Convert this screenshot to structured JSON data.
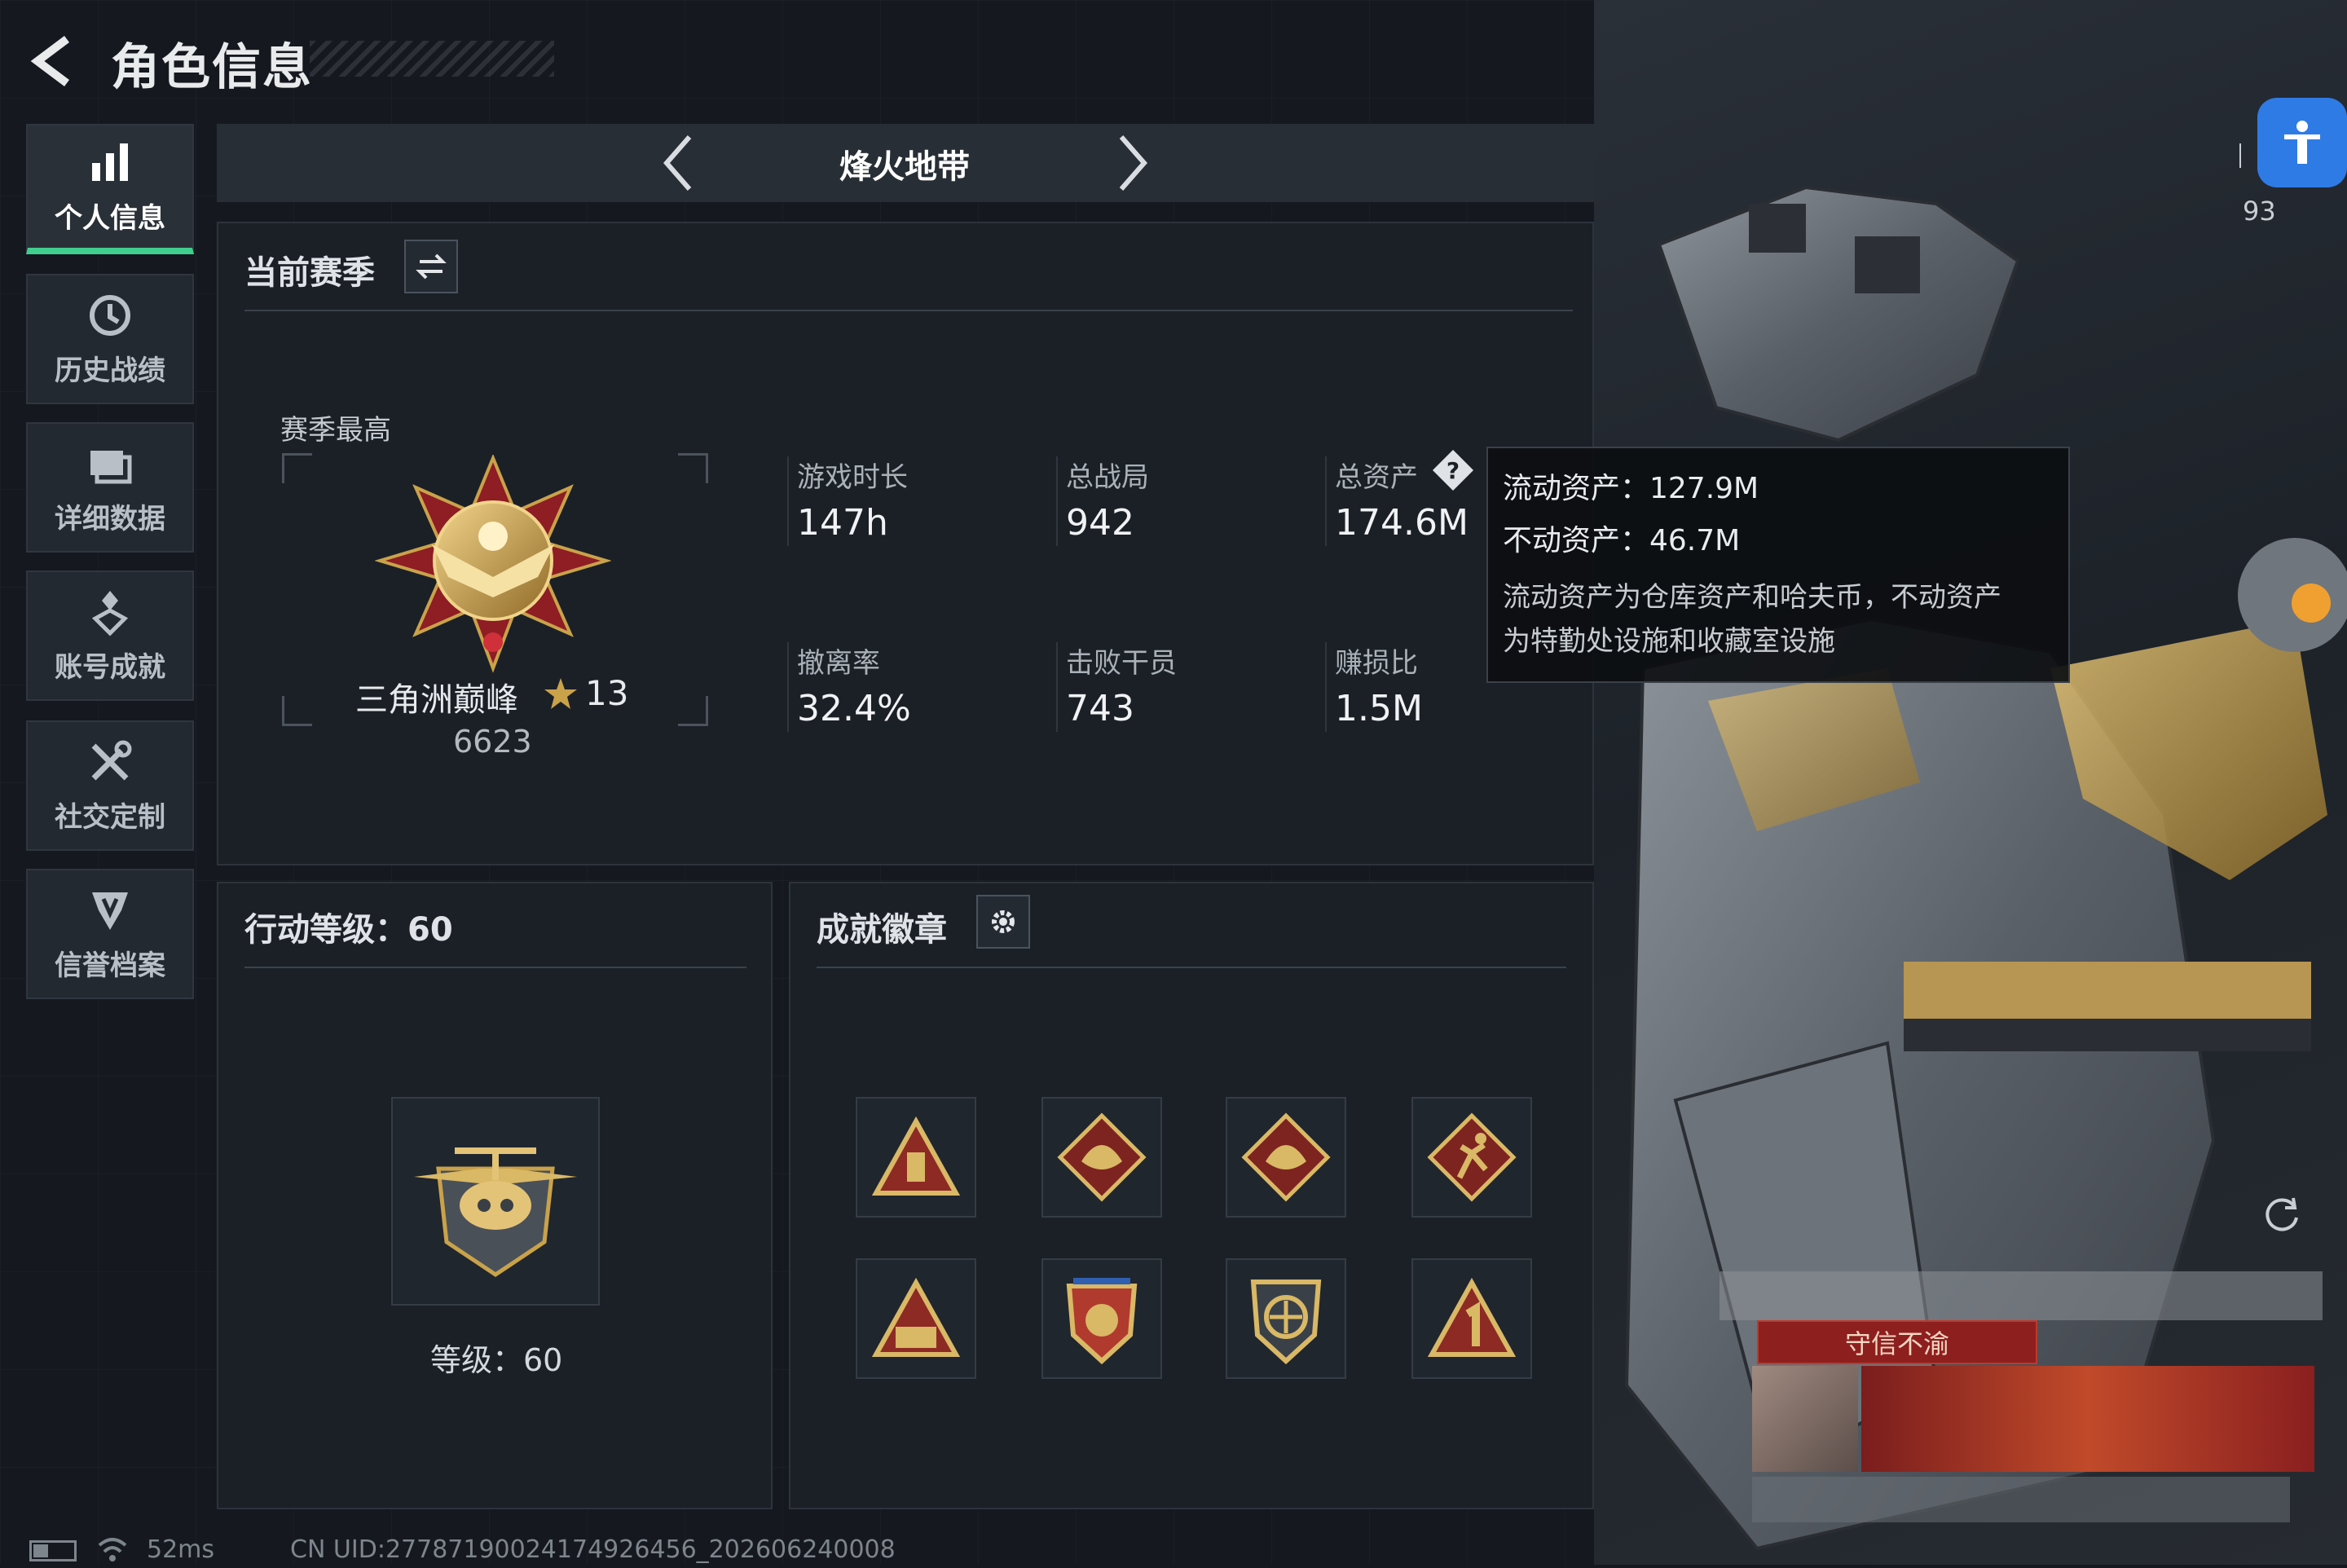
{
  "header": {
    "title": "角色信息"
  },
  "sidebar": {
    "items": [
      {
        "label": "个人信息",
        "icon": "bar-chart-icon",
        "active": true
      },
      {
        "label": "历史战绩",
        "icon": "history-icon"
      },
      {
        "label": "详细数据",
        "icon": "folder-icon"
      },
      {
        "label": "账号成就",
        "icon": "achievement-icon"
      },
      {
        "label": "社交定制",
        "icon": "tools-icon"
      },
      {
        "label": "信誉档案",
        "icon": "shield-icon"
      }
    ]
  },
  "mode": {
    "title": "烽火地带"
  },
  "season": {
    "title": "当前赛季",
    "best_label": "赛季最高",
    "rank_name": "三角洲巅峰",
    "rank_stars": "13",
    "rank_score": "6623",
    "stats": [
      {
        "label": "游戏时长",
        "value": "147h"
      },
      {
        "label": "总战局",
        "value": "942"
      },
      {
        "label": "总资产",
        "value": "174.6M"
      },
      {
        "label": "撤离率",
        "value": "32.4%"
      },
      {
        "label": "击败干员",
        "value": "743"
      },
      {
        "label": "赚损比",
        "value": "1.5M"
      }
    ]
  },
  "tooltip": {
    "liquid": "流动资产：127.9M",
    "fixed": "不动资产：46.7M",
    "desc1": "流动资产为仓库资产和哈夫币，不动资产",
    "desc2": "为特勤处设施和收藏室设施"
  },
  "action_level": {
    "title": "行动等级：60",
    "level_text": "等级：60"
  },
  "badges": {
    "title": "成就徽章"
  },
  "status": {
    "ping": "52ms",
    "uid": "CN UID:27787190024174926456_202606240008",
    "count": "93"
  },
  "character": {
    "title_tag": "守信不渝"
  },
  "colors": {
    "accent_green": "#3fcf8e",
    "gold": "#c9a24a",
    "blue_button": "#2f7be6"
  }
}
